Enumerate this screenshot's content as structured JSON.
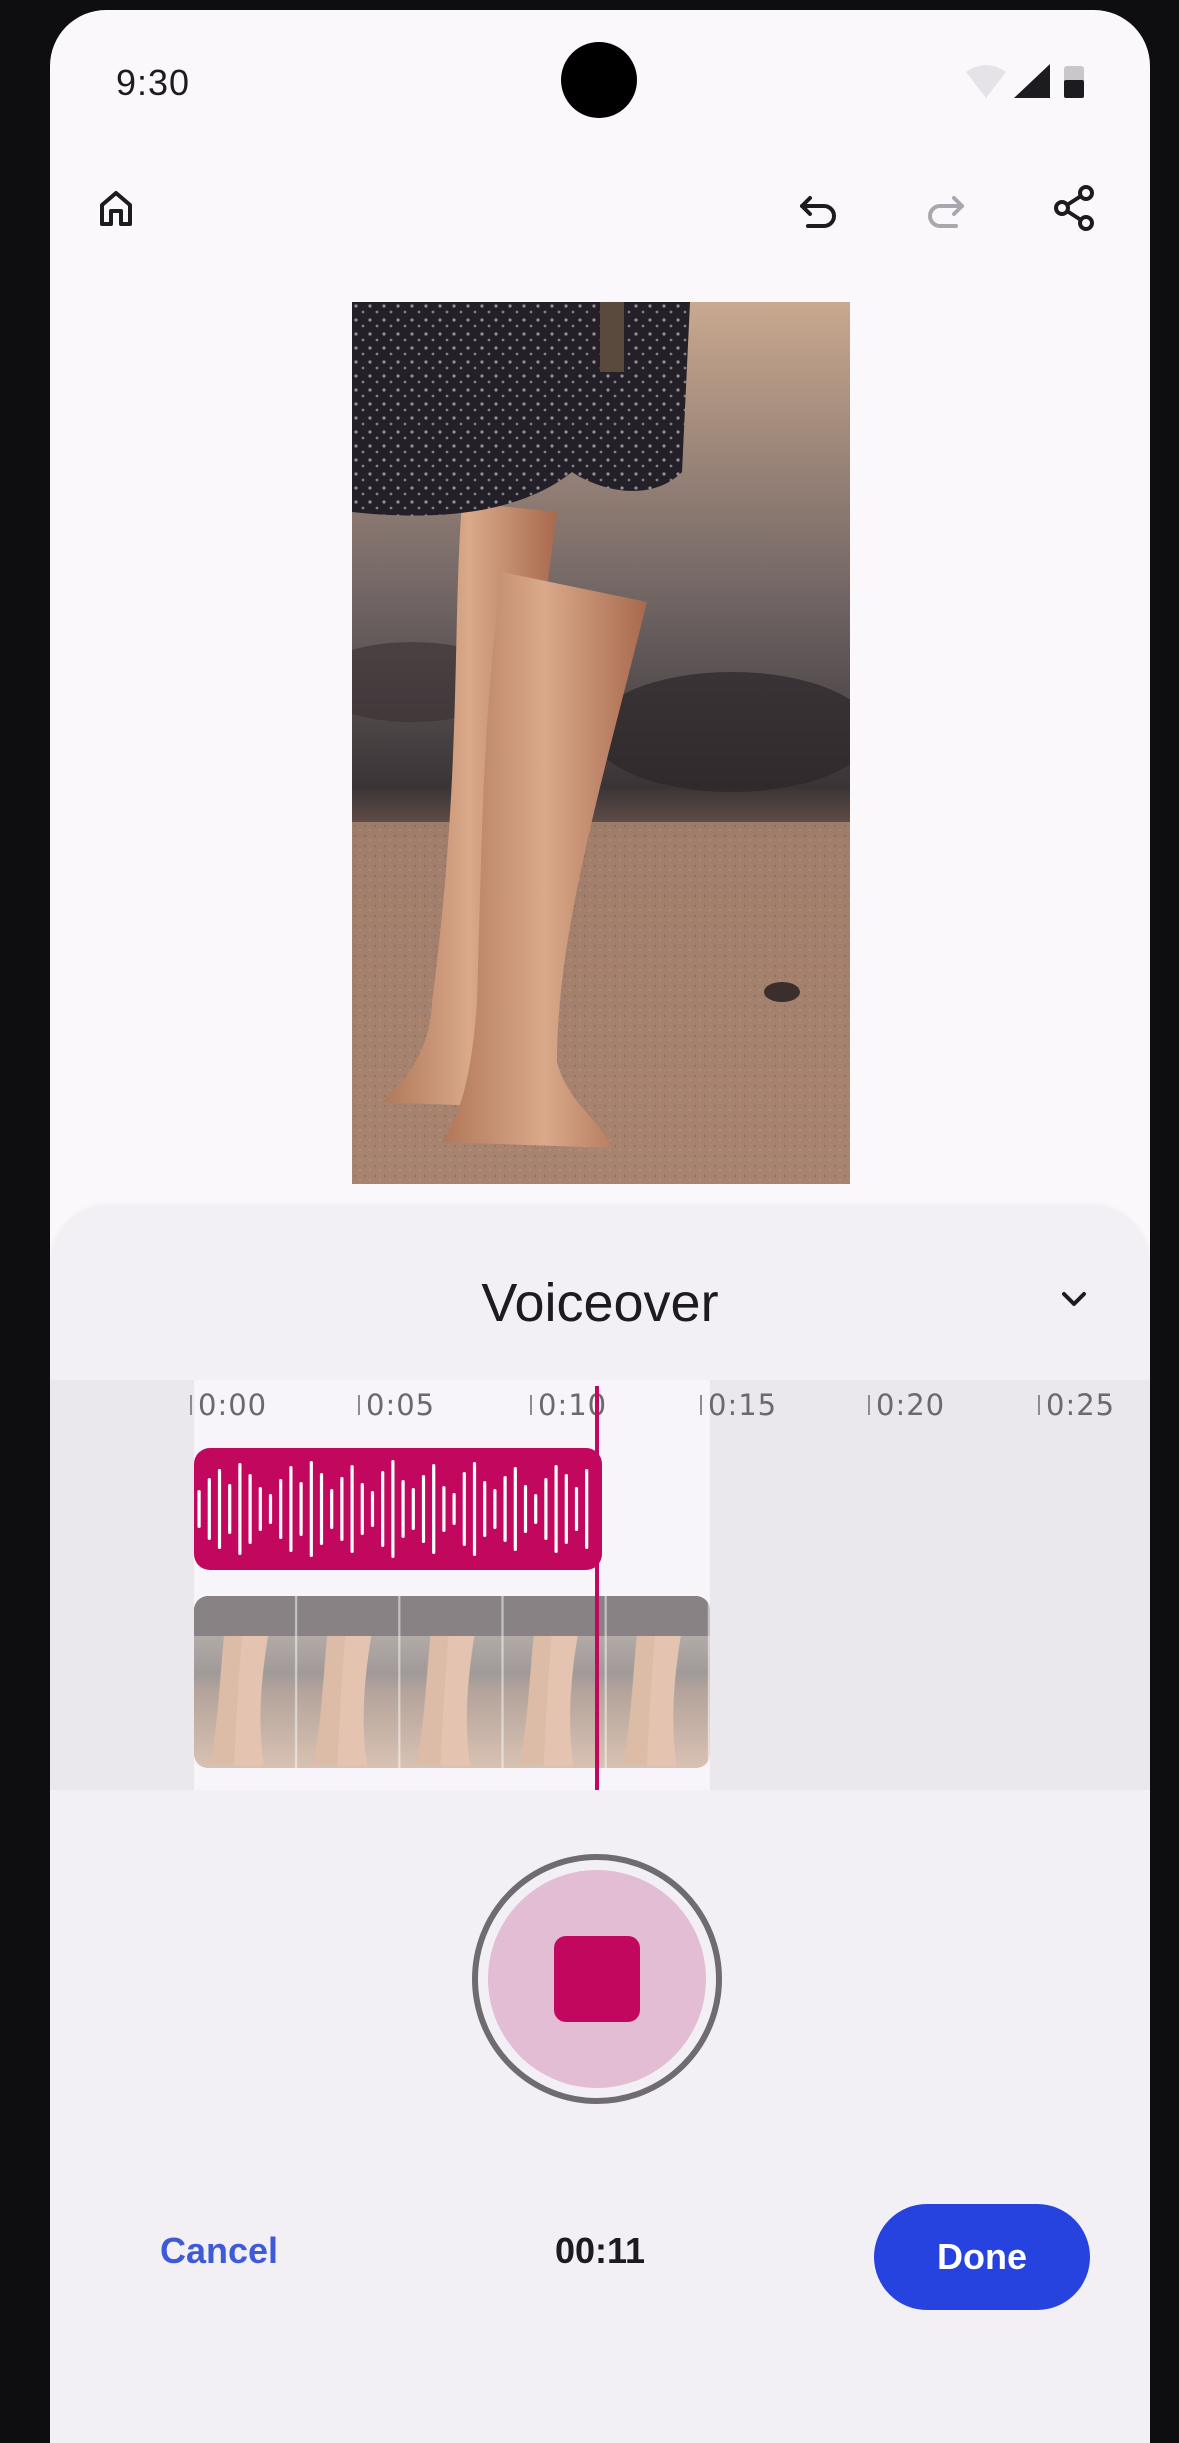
{
  "status_bar": {
    "time": "9:30",
    "icons": [
      "wifi-icon",
      "signal-icon",
      "battery-icon"
    ]
  },
  "top_bar": {
    "icons": [
      "home-icon",
      "undo-icon",
      "redo-icon",
      "share-icon"
    ]
  },
  "sheet": {
    "title": "Voiceover",
    "timeline_ticks": [
      "0:00",
      "0:05",
      "0:10",
      "0:15",
      "0:20",
      "0:25"
    ],
    "timer": "00:11",
    "cancel_label": "Cancel",
    "done_label": "Done"
  },
  "colors": {
    "accent_magenta": "#c2075f",
    "primary_blue": "#2643e0",
    "record_ring_fill": "#e3bdd4"
  }
}
